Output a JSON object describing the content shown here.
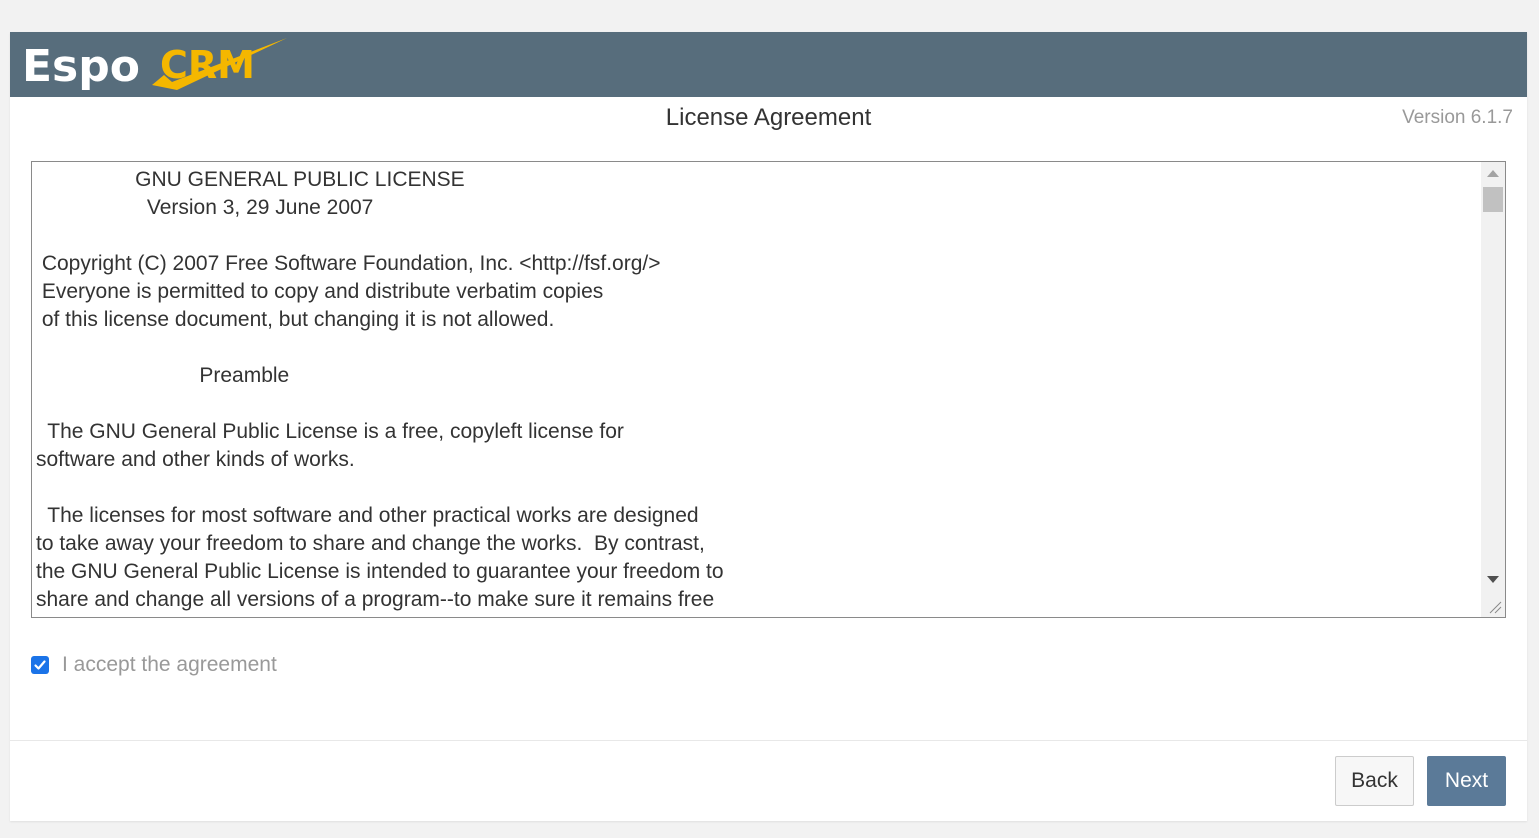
{
  "header": {
    "logo_text_espo": "Espo",
    "logo_text_crm": "CRM",
    "background_color": "#576d7c",
    "logo_accent_color": "#f5b700"
  },
  "page": {
    "title": "License Agreement",
    "version": "Version 6.1.7"
  },
  "license": {
    "text": "                 GNU GENERAL PUBLIC LICENSE\n                   Version 3, 29 June 2007\n\n Copyright (C) 2007 Free Software Foundation, Inc. <http://fsf.org/>\n Everyone is permitted to copy and distribute verbatim copies\n of this license document, but changing it is not allowed.\n\n                            Preamble\n\n  The GNU General Public License is a free, copyleft license for\nsoftware and other kinds of works.\n\n  The licenses for most software and other practical works are designed\nto take away your freedom to share and change the works.  By contrast,\nthe GNU General Public License is intended to guarantee your freedom to\nshare and change all versions of a program--to make sure it remains free"
  },
  "accept": {
    "label": "I accept the agreement",
    "checked": true,
    "checkbox_color": "#1a73e8"
  },
  "footer": {
    "back_label": "Back",
    "next_label": "Next",
    "next_color": "#5b7a98"
  }
}
